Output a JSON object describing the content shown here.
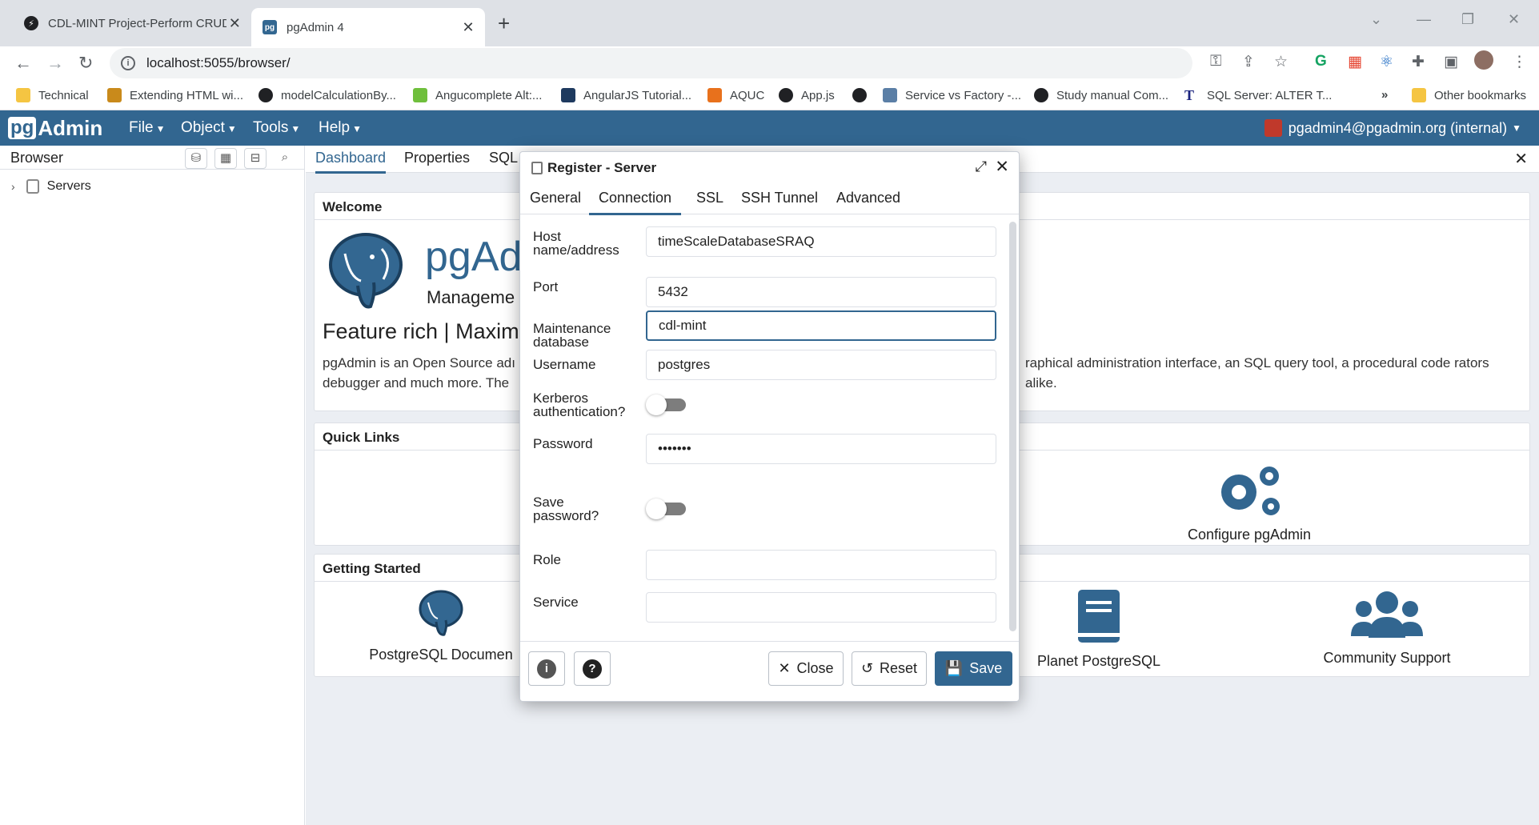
{
  "browser": {
    "tabs": [
      {
        "title": "CDL-MINT Project-Perform CRUD",
        "favicon": "notion-icon"
      },
      {
        "title": "pgAdmin 4",
        "favicon": "pgadmin-icon"
      }
    ],
    "url": "localhost:5055/browser/",
    "bookmarks": [
      {
        "label": "Technical",
        "icon": "folder-icon",
        "color": "#f5c542"
      },
      {
        "label": "Extending HTML wi...",
        "icon": "site-icon",
        "color": "#c98a1b"
      },
      {
        "label": "modelCalculationBy...",
        "icon": "globe-icon",
        "color": "#202124"
      },
      {
        "label": "Angucomplete Alt:...",
        "icon": "site-icon",
        "color": "#6fbf3c"
      },
      {
        "label": "AngularJS Tutorial...",
        "icon": "site-icon",
        "color": "#1e3a5f"
      },
      {
        "label": "AQUC",
        "icon": "site-icon",
        "color": "#e8711c"
      },
      {
        "label": "App.js",
        "icon": "globe-icon",
        "color": "#202124"
      },
      {
        "label": "",
        "icon": "globe-icon",
        "color": "#202124"
      },
      {
        "label": "Service vs Factory -...",
        "icon": "site-icon",
        "color": "#5b7fa6"
      },
      {
        "label": "Study manual Com...",
        "icon": "globe-icon",
        "color": "#202124"
      },
      {
        "label": "SQL Server: ALTER T...",
        "icon": "site-icon",
        "color": "#1a237e"
      }
    ],
    "more": "»",
    "other_bookmarks": "Other bookmarks"
  },
  "pgadmin": {
    "logo_pg": "pg",
    "logo_rest": "Admin",
    "menus": [
      "File",
      "Object",
      "Tools",
      "Help"
    ],
    "user": "pgadmin4@pgadmin.org (internal)"
  },
  "left": {
    "title": "Browser",
    "tree": [
      {
        "label": "Servers"
      }
    ]
  },
  "main": {
    "tabs": [
      "Dashboard",
      "Properties",
      "SQL"
    ],
    "welcome": {
      "heading": "Welcome",
      "title": "pgAd",
      "subtitle": "Manageme",
      "feature": "Feature rich | Maximi",
      "desc_left": "pgAdmin is an Open Source adı debugger and much more. The",
      "desc_right": "raphical administration interface, an SQL query tool, a procedural code rators alike."
    },
    "quick_links": {
      "heading": "Quick Links",
      "items": [
        {
          "label": "Configure pgAdmin"
        }
      ]
    },
    "getting_started": {
      "heading": "Getting Started",
      "items": [
        {
          "label": "PostgreSQL Documen"
        },
        {
          "label": "Planet PostgreSQL"
        },
        {
          "label": "Community Support"
        }
      ]
    }
  },
  "dialog": {
    "title": "Register - Server",
    "tabs": [
      "General",
      "Connection",
      "SSL",
      "SSH Tunnel",
      "Advanced"
    ],
    "active_tab": "Connection",
    "fields": {
      "host": {
        "label": "Host name/address",
        "value": "timeScaleDatabaseSRAQ"
      },
      "port": {
        "label": "Port",
        "value": "5432"
      },
      "maintenance_db": {
        "label": "Maintenance database",
        "value": "cdl-mint"
      },
      "username": {
        "label": "Username",
        "value": "postgres"
      },
      "kerberos": {
        "label": "Kerberos authentication?",
        "value": false
      },
      "password": {
        "label": "Password",
        "value": "•••••••"
      },
      "save_password": {
        "label": "Save password?",
        "value": false
      },
      "role": {
        "label": "Role",
        "value": ""
      },
      "service": {
        "label": "Service",
        "value": ""
      }
    },
    "buttons": {
      "close": "Close",
      "reset": "Reset",
      "save": "Save"
    }
  },
  "colors": {
    "brand": "#326690",
    "chrome": "#dee1e6"
  }
}
